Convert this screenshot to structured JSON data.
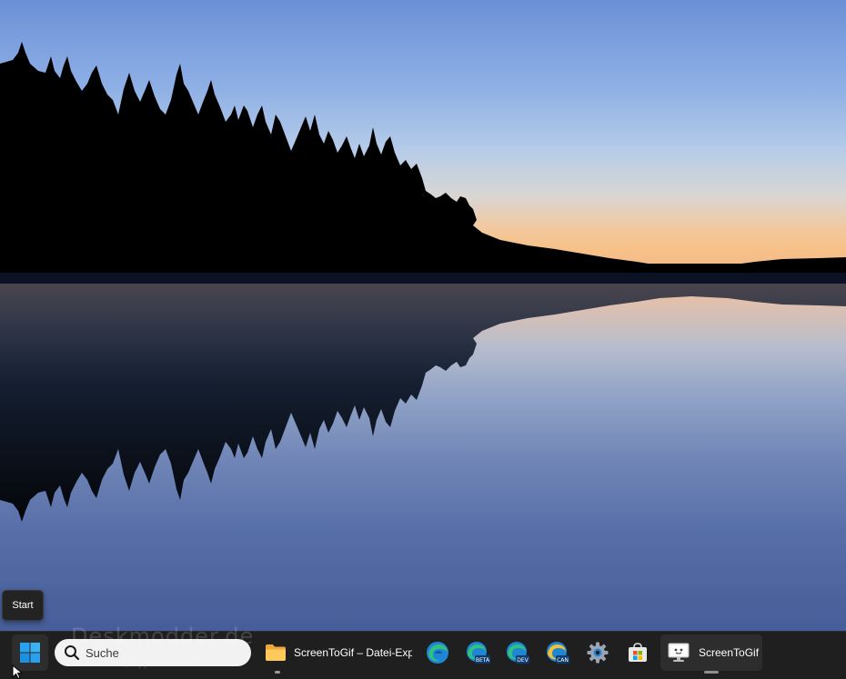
{
  "desktop": {
    "wallpaper": "lake-forest-sunset",
    "watermark": {
      "title": "Deskmodder.de",
      "subtitle": "News, Tipps und Hilfe"
    }
  },
  "tooltip": {
    "label": "Start"
  },
  "taskbar": {
    "start_icon": "windows-logo-icon",
    "search": {
      "label": "Suche",
      "icon": "search-icon"
    },
    "apps": [
      {
        "name": "file-explorer",
        "label": "ScreenToGif – Datei-Explorer",
        "icon": "folder-icon",
        "running": true
      },
      {
        "name": "edge",
        "icon": "edge-icon"
      },
      {
        "name": "edge-beta",
        "icon": "edge-beta-icon",
        "badge": "BETA"
      },
      {
        "name": "edge-dev",
        "icon": "edge-dev-icon",
        "badge": "DEV"
      },
      {
        "name": "edge-canary",
        "icon": "edge-canary-icon",
        "badge": "CAN"
      },
      {
        "name": "settings",
        "icon": "gear-icon"
      },
      {
        "name": "microsoft-store",
        "icon": "store-icon"
      },
      {
        "name": "screentogif",
        "label": "ScreenToGif",
        "icon": "screentogif-icon",
        "running": true,
        "active": true
      }
    ]
  },
  "colors": {
    "taskbar_bg": "#1f1f1f",
    "edge_blue": "#1f86d6",
    "edge_green": "#2ec27e",
    "windows_blue": "#29a3f0"
  }
}
